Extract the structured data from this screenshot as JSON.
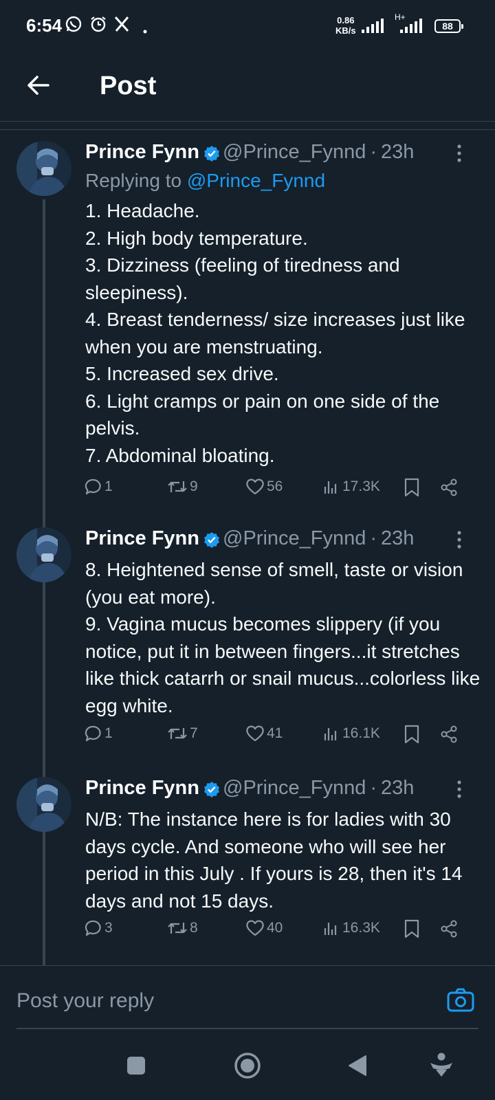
{
  "status_bar": {
    "time": "6:54",
    "net_speed_value": "0.86",
    "net_speed_unit": "KB/s",
    "network_type": "H+",
    "battery": "88",
    "icons": [
      "whatsapp-icon",
      "alarm-icon",
      "x-logo-icon",
      "dot-icon",
      "signal-icon",
      "signal-icon",
      "battery-icon"
    ]
  },
  "header": {
    "title": "Post"
  },
  "tweets": [
    {
      "name": "Prince Fynn",
      "handle": "@Prince_Fynnd",
      "dot": "·",
      "time": "23h",
      "reply_prefix": "Replying to",
      "reply_handle": "@Prince_Fynnd",
      "text": "1. Headache.\n2. High body temperature.\n3. Dizziness (feeling of tiredness and sleepiness).\n4. Breast tenderness/ size increases just like when you are menstruating.\n5. Increased sex drive.\n6. Light cramps or pain on one side of the pelvis.\n7. Abdominal bloating.",
      "replies": "1",
      "reposts": "9",
      "likes": "56",
      "views": "17.3K"
    },
    {
      "name": "Prince Fynn",
      "handle": "@Prince_Fynnd",
      "dot": "·",
      "time": "23h",
      "text": "8. Heightened sense of smell, taste or vision (you eat more).\n9. Vagina mucus becomes slippery (if you notice, put it in between fingers...it stretches like thick catarrh or snail mucus...colorless like egg white.",
      "replies": "1",
      "reposts": "7",
      "likes": "41",
      "views": "16.1K"
    },
    {
      "name": "Prince Fynn",
      "handle": "@Prince_Fynnd",
      "dot": "·",
      "time": "23h",
      "text": "N/B: The instance here is for ladies with 30 days cycle. And someone who will see her period in this July . If yours is 28, then it's 14 days and not 15 days.",
      "replies": "3",
      "reposts": "8",
      "likes": "40",
      "views": "16.3K"
    }
  ],
  "composer": {
    "placeholder": "Post your reply"
  },
  "colors": {
    "background": "#15202b",
    "accent": "#1d9bf0",
    "muted_text": "#8b98a5",
    "divider": "#38444d"
  }
}
